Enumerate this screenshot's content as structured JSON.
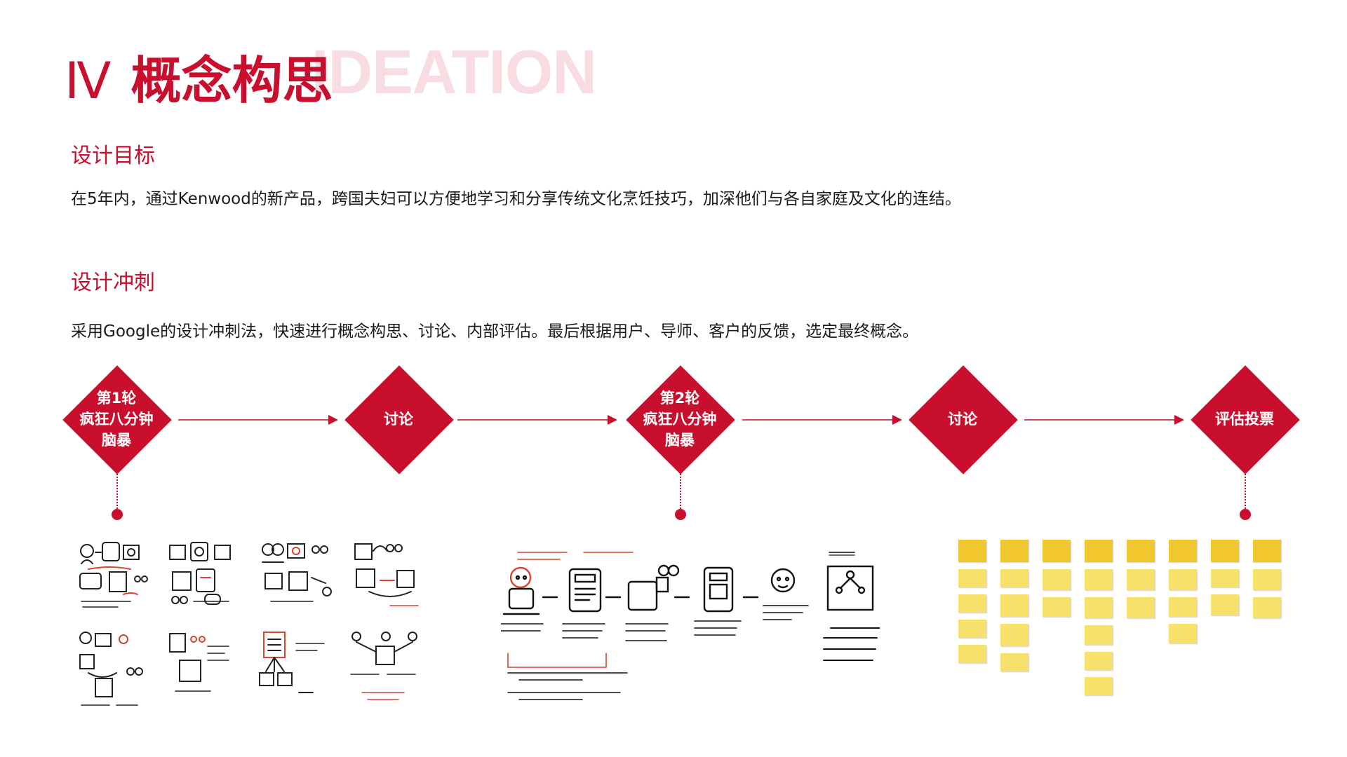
{
  "header": {
    "numeral": "Ⅳ",
    "title": "概念构思",
    "ghost_text": "IDEATION"
  },
  "sections": [
    {
      "heading": "设计目标",
      "text": "在5年内，通过Kenwood的新产品，跨国夫妇可以方便地学习和分享传统文化烹饪技巧，加深他们与各自家庭及文化的连结。"
    },
    {
      "heading": "设计冲刺",
      "text": "采用Google的设计冲刺法，快速进行概念构思、讨论、内部评估。最后根据用户、导师、客户的反馈，选定最终概念。"
    }
  ],
  "flow": {
    "steps": [
      {
        "label": "第1轮\n疯狂八分钟\n脑暴",
        "has_dot": true
      },
      {
        "label": "讨论",
        "has_dot": false
      },
      {
        "label": "第2轮\n疯狂八分钟\n脑暴",
        "has_dot": true
      },
      {
        "label": "讨论",
        "has_dot": false
      },
      {
        "label": "评估投票",
        "has_dot": true
      }
    ]
  },
  "images": [
    {
      "icon": "crazy-eights-sketches-round-1"
    },
    {
      "icon": "concept-storyboard-sketch-round-2"
    },
    {
      "icon": "sticky-notes-voting-board"
    }
  ],
  "colors": {
    "accent": "#c8102e",
    "ghost": "#f7dde1",
    "sticky": "#f6e16a"
  }
}
